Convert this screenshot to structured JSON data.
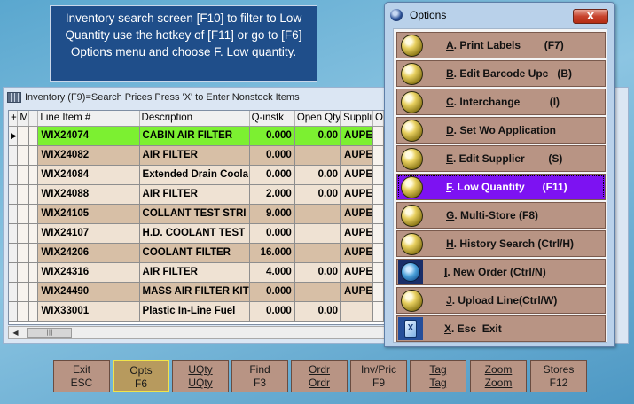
{
  "callout": {
    "text": "Inventory search screen [F10] to filter to Low Quantity use the hotkey of [F11] or go to [F6] Options menu and choose F. Low quantity."
  },
  "inventory": {
    "title": "Inventory (F9)=Search Prices  Press 'X' to Enter Nonstock Items",
    "columns": [
      "+",
      "M",
      "Line Item #",
      "Description",
      "Q-instk",
      "Open Qty",
      "Suppli",
      "O"
    ],
    "rows": [
      {
        "item": "WIX24074",
        "desc": "CABIN AIR FILTER",
        "qty": "0.000",
        "open": "0.00",
        "supplier": "AUPE",
        "style": "sel",
        "indicator": "▶"
      },
      {
        "item": "WIX24082",
        "desc": "AIR FILTER",
        "qty": "0.000",
        "open": "",
        "supplier": "AUPE",
        "style": "tan",
        "indicator": ""
      },
      {
        "item": "WIX24084",
        "desc": "Extended Drain Coola",
        "qty": "0.000",
        "open": "0.00",
        "supplier": "AUPE",
        "style": "light",
        "indicator": ""
      },
      {
        "item": "WIX24088",
        "desc": "AIR FILTER",
        "qty": "2.000",
        "open": "0.00",
        "supplier": "AUPE",
        "style": "light",
        "indicator": ""
      },
      {
        "item": "WIX24105",
        "desc": "COLLANT TEST STRI",
        "qty": "9.000",
        "open": "",
        "supplier": "AUPE",
        "style": "tan",
        "indicator": ""
      },
      {
        "item": "WIX24107",
        "desc": "H.D. COOLANT TEST",
        "qty": "0.000",
        "open": "",
        "supplier": "AUPE",
        "style": "light",
        "indicator": ""
      },
      {
        "item": "WIX24206",
        "desc": "COOLANT FILTER",
        "qty": "16.000",
        "open": "",
        "supplier": "AUPE",
        "style": "tan",
        "indicator": ""
      },
      {
        "item": "WIX24316",
        "desc": "AIR FILTER",
        "qty": "4.000",
        "open": "0.00",
        "supplier": "AUPE",
        "style": "light",
        "indicator": ""
      },
      {
        "item": "WIX24490",
        "desc": "MASS AIR FILTER KIT",
        "qty": "0.000",
        "open": "",
        "supplier": "AUPE",
        "style": "tan",
        "indicator": ""
      },
      {
        "item": "WIX33001",
        "desc": "Plastic In-Line Fuel",
        "qty": "0.000",
        "open": "0.00",
        "supplier": "",
        "style": "light",
        "indicator": ""
      }
    ],
    "scroll_thumb": "|||"
  },
  "buttons": [
    {
      "line1": "Exit",
      "line2": "ESC",
      "active": false,
      "underline": false
    },
    {
      "line1": "Opts",
      "line2": "F6",
      "active": true,
      "underline": false
    },
    {
      "line1": "UQty",
      "line2": "UQty",
      "active": false,
      "underline": true
    },
    {
      "line1": "Find",
      "line2": "F3",
      "active": false,
      "underline": false
    },
    {
      "line1": "Ordr",
      "line2": "Ordr",
      "active": false,
      "underline": true
    },
    {
      "line1": "Inv/Pric",
      "line2": "F9",
      "active": false,
      "underline": false
    },
    {
      "line1": "Tag",
      "line2": "Tag",
      "active": false,
      "underline": true
    },
    {
      "line1": "Zoom",
      "line2": "Zoom",
      "active": false,
      "underline": true
    },
    {
      "line1": "Stores",
      "line2": "F12",
      "active": false,
      "underline": false
    }
  ],
  "options": {
    "title": "Options",
    "close": "X",
    "items": [
      {
        "key": "A",
        "rest": ". Print Labels        (F7)",
        "icon": "gold-globe-icon",
        "selected": false
      },
      {
        "key": "B",
        "rest": ". Edit Barcode Upc   (B)",
        "icon": "gold-globe-icon",
        "selected": false
      },
      {
        "key": "C",
        "rest": ". Interchange          (I)",
        "icon": "gold-globe-icon",
        "selected": false
      },
      {
        "key": "D",
        "rest": ". Set Wo Application",
        "icon": "gold-globe-icon",
        "selected": false
      },
      {
        "key": "E",
        "rest": ". Edit Supplier        (S)",
        "icon": "gold-globe-icon",
        "selected": false
      },
      {
        "key": "F",
        "rest": ". Low Quantity      (F11)",
        "icon": "gold-globe-icon",
        "selected": true
      },
      {
        "key": "G",
        "rest": ". Multi-Store (F8)",
        "icon": "gold-globe-icon",
        "selected": false
      },
      {
        "key": "H",
        "rest": ". History Search (Ctrl/H)",
        "icon": "gold-globe-icon",
        "selected": false
      },
      {
        "key": "I",
        "rest": ". New Order (Ctrl/N)",
        "icon": "blue-globe-icon",
        "selected": false
      },
      {
        "key": "J",
        "rest": ". Upload Line(Ctrl/W)",
        "icon": "gold-globe-icon",
        "selected": false
      },
      {
        "key": "X",
        "rest": ". Esc  Exit",
        "icon": "exit-door-icon",
        "selected": false
      }
    ]
  }
}
